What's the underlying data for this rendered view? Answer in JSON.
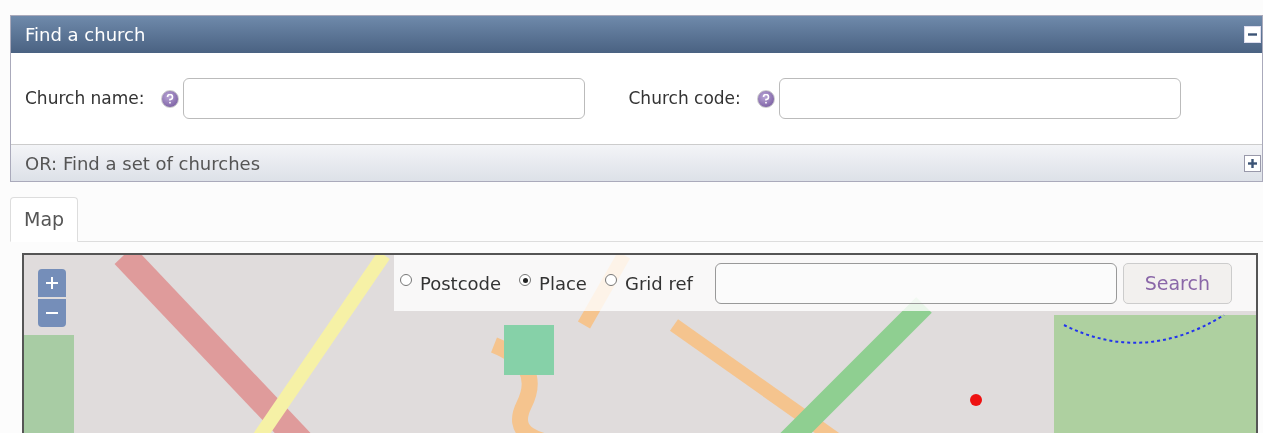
{
  "panel": {
    "title": "Find a church",
    "expanded": true,
    "fields": [
      {
        "label": "Church name:"
      },
      {
        "label": "Church code:"
      }
    ]
  },
  "subpanel": {
    "title": "OR: Find a set of churches",
    "expanded": false
  },
  "tabs": [
    {
      "label": "Map",
      "selected": true
    }
  ],
  "map_search": {
    "options": [
      {
        "label": "Postcode",
        "selected": false
      },
      {
        "label": "Place",
        "selected": true
      },
      {
        "label": "Grid ref",
        "selected": false
      }
    ],
    "button": "Search"
  }
}
